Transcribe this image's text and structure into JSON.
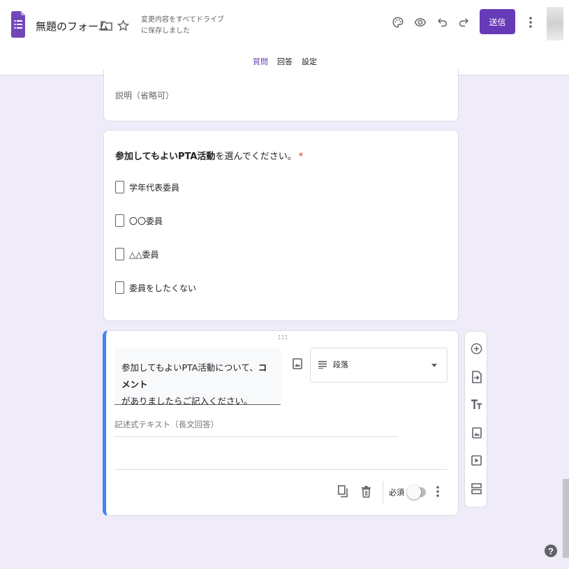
{
  "header": {
    "title": "無題のフォーム",
    "save_status": "変更内容をすべてドライブに保存しました",
    "send_label": "送信",
    "accent_color": "#673ab7"
  },
  "tabs": [
    {
      "label": "質問",
      "active": true
    },
    {
      "label": "回答",
      "active": false
    },
    {
      "label": "設定",
      "active": false
    }
  ],
  "description_card": {
    "placeholder": "説明（省略可）"
  },
  "checkbox_question": {
    "title_bold": "参加してもよいPTA活動",
    "title_rest": "を選んでください。",
    "required_mark": "*",
    "options": [
      "学年代表委員",
      "〇〇委員",
      "△△委員",
      "委員をしたくない"
    ]
  },
  "active_question": {
    "text_part1": "参加してもよいPTA活動について、",
    "text_bold": "コメント",
    "text_part2": "がありましたらご記入ください。",
    "type_label": "段落",
    "answer_hint": "記述式テキスト（長文回答）",
    "required_label": "必須",
    "required_on": false
  },
  "side_toolbar": [
    "add-question",
    "import-questions",
    "add-title",
    "add-image",
    "add-video",
    "add-section"
  ]
}
